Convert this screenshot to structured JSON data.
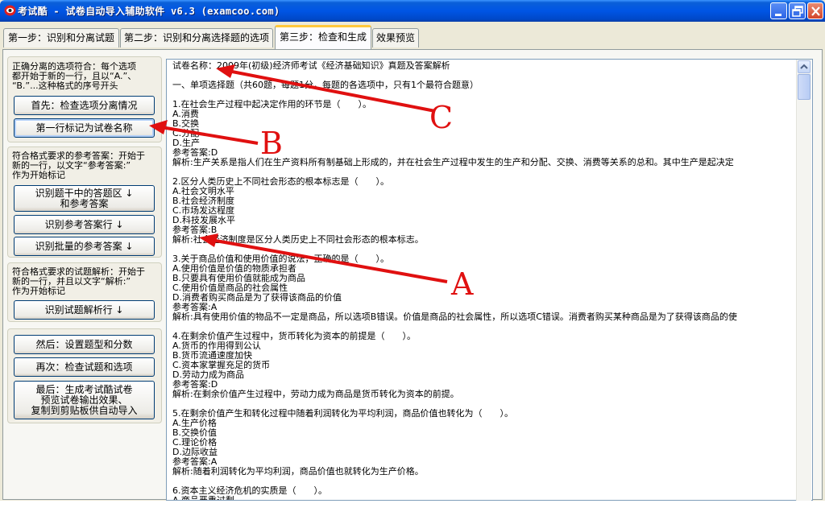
{
  "window": {
    "title": "考试酷 - 试卷自动导入辅助软件 v6.3 (examcoo.com)",
    "controls": [
      "minimize-icon",
      "restore-icon",
      "close-icon"
    ]
  },
  "tabs": [
    {
      "label": "第一步：识别和分离试题",
      "active": false
    },
    {
      "label": "第二步：识别和分离选择题的选项",
      "active": false
    },
    {
      "label": "第三步：检查和生成",
      "active": true
    },
    {
      "label": "效果预览",
      "active": false
    }
  ],
  "left": {
    "group1_text": [
      "正确分离的选项符合：每个选项",
      "都开始于新的一行，且以“A.”、",
      "“B.”...这种格式的序号开头"
    ],
    "btn_check_options": "首先：检查选项分离情况",
    "btn_mark_title": "第一行标记为试卷名称",
    "group2_text": [
      "符合格式要求的参考答案：开始于",
      "新的一行，以文字“参考答案:”",
      "作为开始标记"
    ],
    "btn_answer_area": [
      "识别题干中的答题区 ↓",
      "和参考答案"
    ],
    "btn_answer_line": "识别参考答案行 ↓",
    "btn_batch_answer": "识别批量的参考答案 ↓",
    "group3_text": [
      "符合格式要求的试题解析：开始于",
      "新的一行，并且以文字“解析:”",
      "作为开始标记"
    ],
    "btn_analysis": "识别试题解析行 ↓",
    "btn_set_type": "然后：设置题型和分数",
    "btn_check_again": "再次：检查试题和选项",
    "btn_generate": [
      "最后：生成考试酷试卷",
      "预览试卷输出效果、",
      "复制到剪贴板供自动导入"
    ]
  },
  "editor": {
    "lines": [
      "试卷名称：2009年(初级)经济师考试《经济基础知识》真题及答案解析",
      "",
      "一、单项选择题（共60题，每题1分，每题的各选项中，只有1个最符合题意）",
      "",
      "1.在社会生产过程中起决定作用的环节是（　　）。",
      "A.消费",
      "B.交换",
      "C.分配",
      "D.生产",
      "参考答案:D",
      "解析:生产关系是指人们在生产资料所有制基础上形成的，并在社会生产过程中发生的生产和分配、交换、消费等关系的总和。其中生产是起决定",
      "",
      "2.区分人类历史上不同社会形态的根本标志是（　　）。",
      "A.社会文明水平",
      "B.社会经济制度",
      "C.市场发达程度",
      "D.科技发展水平",
      "参考答案:B",
      "解析:社会经济制度是区分人类历史上不同社会形态的根本标志。",
      "",
      "3.关于商品价值和使用价值的说法，正确的是（　　）。",
      "A.使用价值是价值的物质承担者",
      "B.只要具有使用价值就能成为商品",
      "C.使用价值是商品的社会属性",
      "D.消费者购买商品是为了获得该商品的价值",
      "参考答案:A",
      "解析:具有使用价值的物品不一定是商品，所以选项B错误。价值是商品的社会属性，所以选项C错误。消费者购买某种商品是为了获得该商品的使",
      "",
      "4.在剩余价值产生过程中，货币转化为资本的前提是（　　）。",
      "A.货币的作用得到公认",
      "B.货币流通速度加快",
      "C.资本家掌握充足的货币",
      "D.劳动力成为商品",
      "参考答案:D",
      "解析:在剩余价值产生过程中，劳动力成为商品是货币转化为资本的前提。",
      "",
      "5.在剩余价值产生和转化过程中随着利润转化为平均利润，商品价值也转化为（　　）。",
      "A.生产价格",
      "B.交换价值",
      "C.理论价格",
      "D.边际收益",
      "参考答案:A",
      "解析:随着利润转化为平均利润，商品价值也就转化为生产价格。",
      "",
      "6.资本主义经济危机的实质是（　　）。",
      "A.商品严重过剩"
    ]
  },
  "annotations": {
    "a": "A",
    "b": "B",
    "c": "C",
    "color": "#e01010"
  }
}
